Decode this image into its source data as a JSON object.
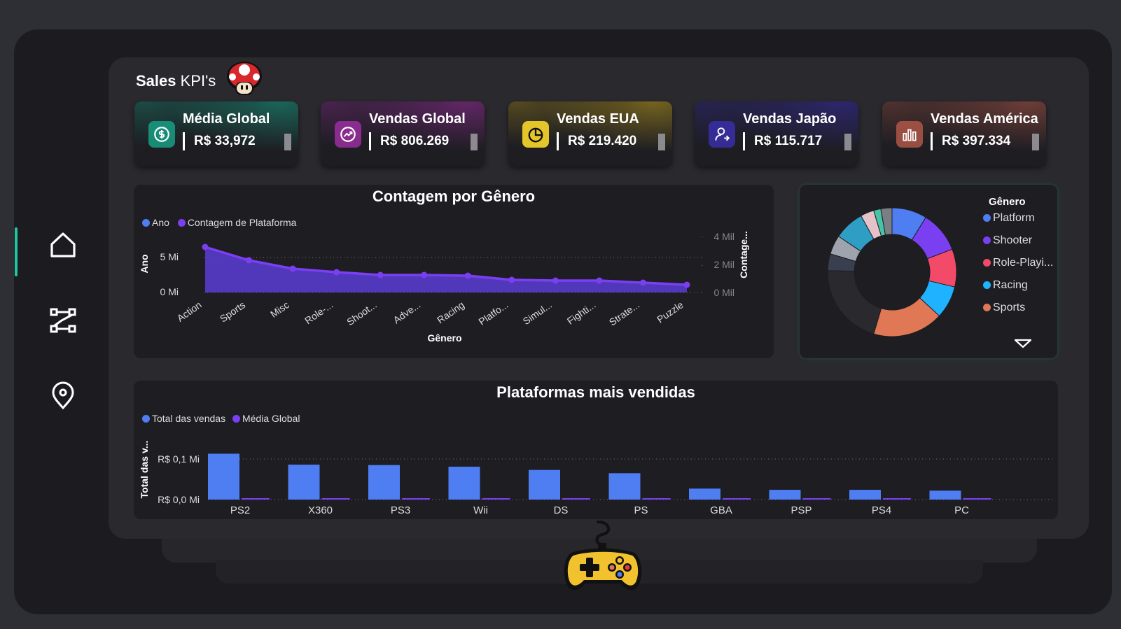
{
  "header": {
    "title_bold": "Sales",
    "title_rest": " KPI's"
  },
  "colors": {
    "blue": "#4f7df2",
    "purple": "#7b3ff2",
    "teal": "#1fc6a0",
    "bg": "#1c1c20"
  },
  "nav": {
    "items": [
      {
        "name": "home",
        "icon": "home-icon"
      },
      {
        "name": "flow",
        "icon": "flow-icon"
      },
      {
        "name": "map",
        "icon": "map-pin-icon"
      }
    ]
  },
  "kpis": [
    {
      "title": "Média Global",
      "value": "R$ 33,972",
      "icon": "dollar-cycle-icon",
      "accent": "#18a58a"
    },
    {
      "title": "Vendas Global",
      "value": "R$ 806.269",
      "icon": "trend-icon",
      "accent": "#a12fa6"
    },
    {
      "title": "Vendas EUA",
      "value": "R$ 219.420",
      "icon": "pie-chart-icon",
      "accent": "#c2a11c"
    },
    {
      "title": "Vendas Japão",
      "value": "R$ 115.717",
      "icon": "user-arrow-icon",
      "accent": "#3b2fb0"
    },
    {
      "title": "Vendas América",
      "value": "R$ 397.334",
      "icon": "bar-chart-icon",
      "accent": "#b65a4a"
    }
  ],
  "genre_chart": {
    "title": "Contagem por Gênero",
    "legend": [
      "Ano",
      "Contagem de Plataforma"
    ],
    "xlabel": "Gênero",
    "ylabel_left": "Ano",
    "ylabel_right": "Contage...",
    "left_ticks": [
      "5 Mi",
      "0 Mi"
    ],
    "right_ticks": [
      "4 Mil",
      "2 Mil",
      "0 Mil"
    ]
  },
  "chart_data": [
    {
      "type": "area",
      "categories": [
        "Action",
        "Sports",
        "Misc",
        "Role-...",
        "Shoot...",
        "Adve...",
        "Racing",
        "Platfo...",
        "Simul...",
        "Fighti...",
        "Strate...",
        "Puzzle"
      ],
      "series": [
        {
          "name": "Ano",
          "values": [
            6.5,
            4.6,
            3.4,
            2.9,
            2.5,
            2.5,
            2.4,
            1.8,
            1.7,
            1.7,
            1.4,
            1.1
          ]
        }
      ],
      "xlabel": "Gênero",
      "ylabel": "Ano",
      "ylim": [
        0,
        10
      ]
    },
    {
      "type": "bar",
      "title": "Plataformas mais vendidas",
      "categories": [
        "PS2",
        "X360",
        "PS3",
        "Wii",
        "DS",
        "PS",
        "GBA",
        "PSP",
        "PS4",
        "PC"
      ],
      "series": [
        {
          "name": "Total das vendas",
          "values": [
            0.113,
            0.086,
            0.085,
            0.081,
            0.073,
            0.065,
            0.027,
            0.024,
            0.024,
            0.022
          ]
        },
        {
          "name": "Média Global",
          "values": [
            0.0006,
            0.0006,
            0.0006,
            0.0006,
            0.0006,
            0.0006,
            0.0006,
            0.0006,
            0.0006,
            0.0006
          ]
        }
      ],
      "ylabel": "Total das v...",
      "yticks": [
        "R$ 0,1 Mi",
        "R$ 0,0 Mi"
      ],
      "ylim": [
        0,
        0.1
      ]
    },
    {
      "type": "pie",
      "title": "Gênero",
      "categories": [
        "Platform",
        "Shooter",
        "Role-Playi...",
        "Racing",
        "Sports",
        "other-dark",
        "other-slate",
        "other-gray",
        "other-teal",
        "other-pink",
        "other-mint",
        "other-grey2"
      ],
      "values": [
        8.8,
        10.4,
        9.5,
        8.2,
        17.7,
        20.8,
        4.2,
        4.8,
        7.6,
        3.4,
        1.8,
        2.8
      ],
      "colors": [
        "#4f7df2",
        "#7b3ff2",
        "#f44a6a",
        "#1fb3ff",
        "#e07755",
        "#2a2a2e",
        "#3a3f4f",
        "#9ea3ad",
        "#2f9ec4",
        "#e4c2c8",
        "#47c4a6",
        "#7a7f86"
      ]
    }
  ],
  "pie_legend": {
    "title": "Gênero",
    "items": [
      {
        "label": "Platform",
        "color": "#4f7df2"
      },
      {
        "label": "Shooter",
        "color": "#7b3ff2"
      },
      {
        "label": "Role-Playi...",
        "color": "#f44a6a"
      },
      {
        "label": "Racing",
        "color": "#1fb3ff"
      },
      {
        "label": "Sports",
        "color": "#e07755"
      }
    ]
  },
  "platform_chart": {
    "title": "Plataformas mais vendidas",
    "legend": [
      "Total das vendas",
      "Média Global"
    ]
  }
}
